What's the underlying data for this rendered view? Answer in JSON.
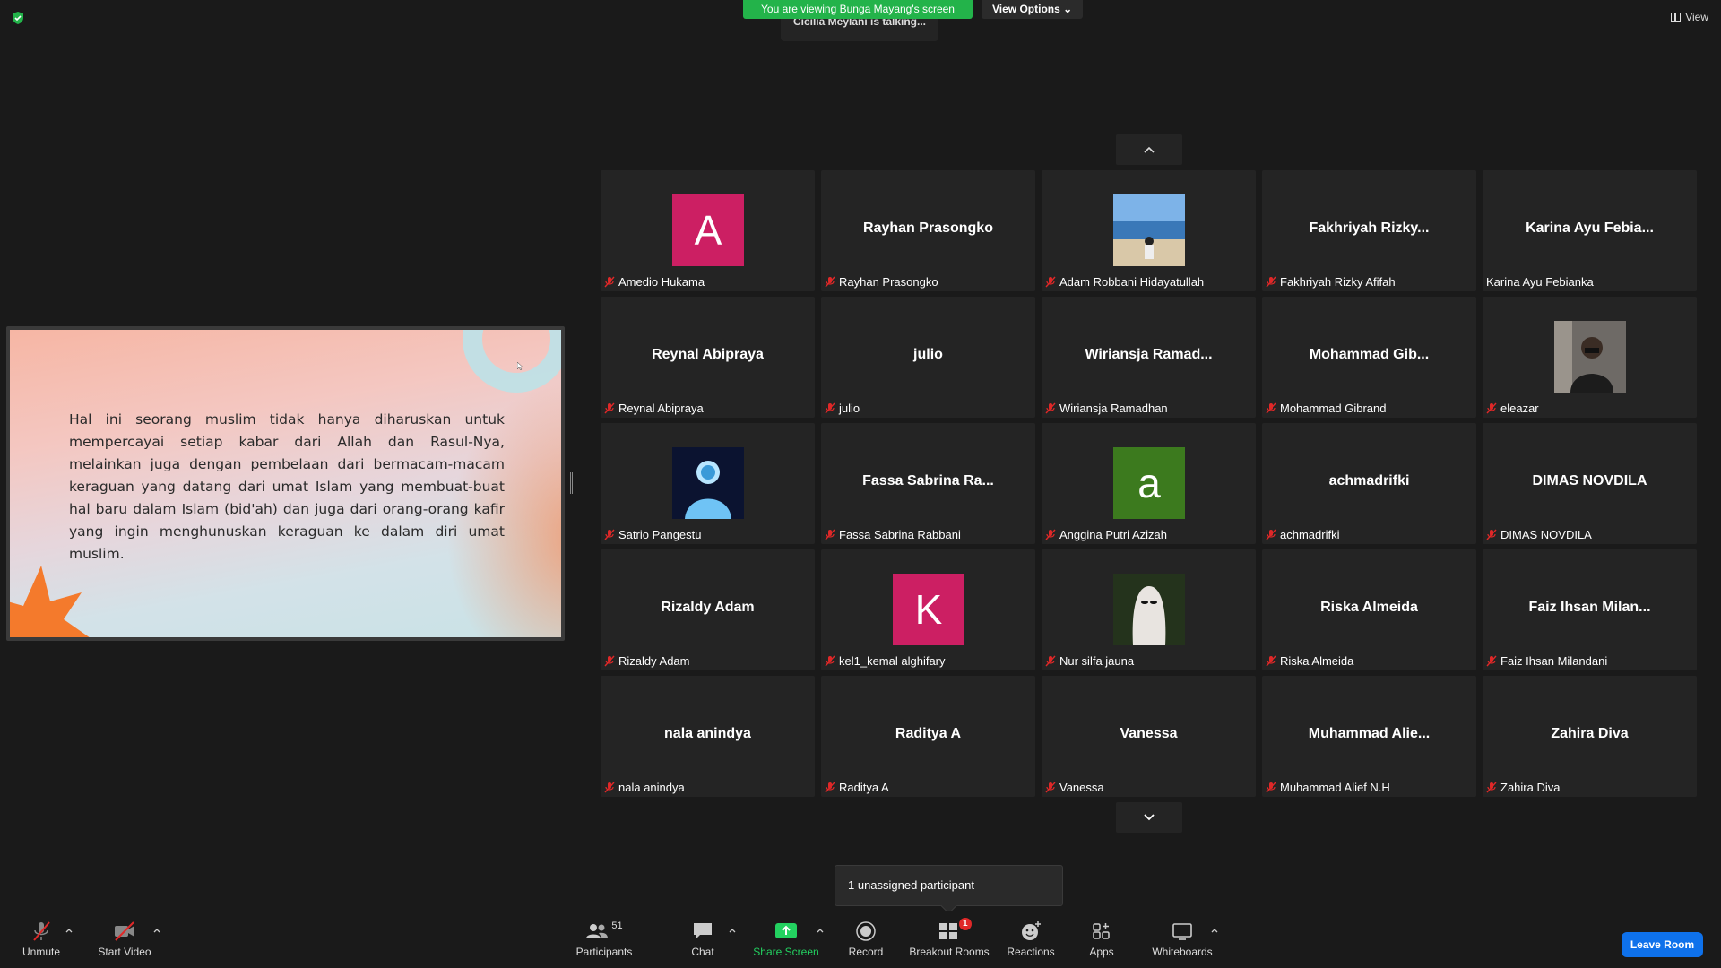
{
  "top": {
    "viewing_banner": "You are viewing Bunga Mayang's screen",
    "view_options": "View Options",
    "talking": "Cicilia Meylani is talking...",
    "view": "View"
  },
  "slide": {
    "text": "Hal ini seorang muslim tidak hanya diharuskan untuk mempercayai setiap kabar dari Allah dan Rasul-Nya, melainkan juga dengan pembelaan dari bermacam-macam keraguan yang datang dari umat Islam yang membuat-buat hal baru dalam Islam (bid'ah) dan juga dari orang-orang kafir yang ingin menghunuskan keraguan ke dalam diri umat muslim."
  },
  "tiles": [
    {
      "big": "",
      "label": "Amedio Hukama",
      "avatar": "A",
      "avatar_color": "#cc1f63",
      "muted": true
    },
    {
      "big": "Rayhan Prasongko",
      "label": "Rayhan Prasongko",
      "muted": true
    },
    {
      "big": "",
      "label": "Adam Robbani Hidayatullah",
      "photo": "beach",
      "muted": true
    },
    {
      "big": "Fakhriyah  Rizky...",
      "label": "Fakhriyah Rizky Afifah",
      "muted": true
    },
    {
      "big": "Karina  Ayu  Febia...",
      "label": "Karina Ayu Febianka",
      "muted": false
    },
    {
      "big": "Reynal Abipraya",
      "label": "Reynal Abipraya",
      "muted": true
    },
    {
      "big": "julio",
      "label": "julio",
      "muted": true
    },
    {
      "big": "Wiriansja  Ramad...",
      "label": "Wiriansja Ramadhan",
      "muted": true
    },
    {
      "big": "Mohammad  Gib...",
      "label": "Mohammad Gibrand",
      "muted": true
    },
    {
      "big": "",
      "label": "eleazar",
      "photo": "street",
      "muted": true
    },
    {
      "big": "",
      "label": "Satrio Pangestu",
      "photo": "blue",
      "muted": true
    },
    {
      "big": "Fassa Sabrina Ra...",
      "label": "Fassa Sabrina Rabbani",
      "muted": true
    },
    {
      "big": "",
      "label": "Anggina Putri Azizah",
      "avatar": "a",
      "avatar_color": "#3c7a1e",
      "muted": true
    },
    {
      "big": "achmadrifki",
      "label": "achmadrifki",
      "muted": true
    },
    {
      "big": "DIMAS NOVDILA",
      "label": "DIMAS NOVDILA",
      "muted": true
    },
    {
      "big": "Rizaldy Adam",
      "label": "Rizaldy Adam",
      "muted": true
    },
    {
      "big": "",
      "label": "kel1_kemal alghifary",
      "avatar": "K",
      "avatar_color": "#cc1f63",
      "muted": true
    },
    {
      "big": "",
      "label": "Nur silfa jauna",
      "photo": "ghost",
      "muted": true
    },
    {
      "big": "Riska Almeida",
      "label": "Riska Almeida",
      "muted": true
    },
    {
      "big": "Faiz  Ihsan  Milan...",
      "label": "Faiz Ihsan Milandani",
      "muted": true
    },
    {
      "big": "nala anindya",
      "label": "nala anindya",
      "muted": true
    },
    {
      "big": "Raditya A",
      "label": "Raditya A",
      "muted": true
    },
    {
      "big": "Vanessa",
      "label": "Vanessa",
      "muted": true
    },
    {
      "big": "Muhammad  Alie...",
      "label": "Muhammad Alief N.H",
      "muted": true
    },
    {
      "big": "Zahira Diva",
      "label": "Zahira Diva",
      "muted": true
    }
  ],
  "tooltip": "1 unassigned participant",
  "toolbar": {
    "unmute": "Unmute",
    "start_video": "Start Video",
    "participants": "Participants",
    "participants_count": "51",
    "chat": "Chat",
    "share_screen": "Share Screen",
    "record": "Record",
    "breakout_rooms": "Breakout Rooms",
    "breakout_badge": "1",
    "reactions": "Reactions",
    "apps": "Apps",
    "whiteboards": "Whiteboards",
    "leave": "Leave Room"
  },
  "colors": {
    "green": "#23b34a",
    "leave": "#0e71eb",
    "muted_mic": "#e02828"
  }
}
